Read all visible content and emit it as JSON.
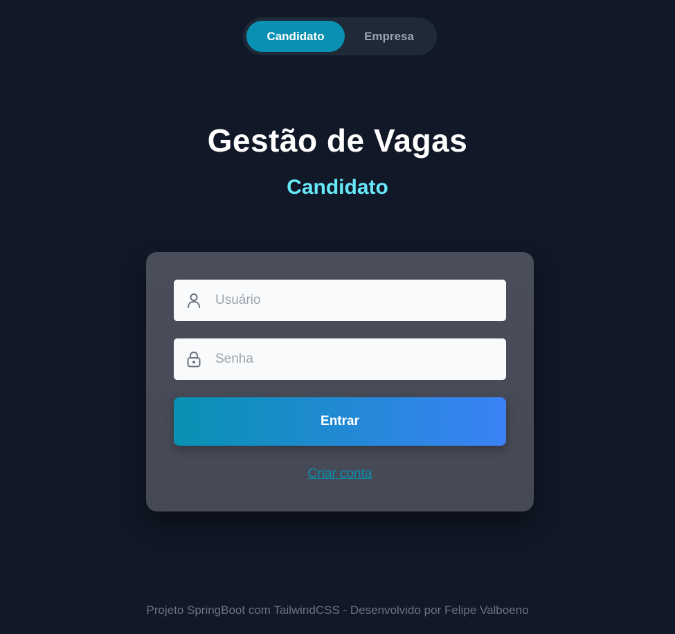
{
  "toggle": {
    "candidate_label": "Candidato",
    "company_label": "Empresa"
  },
  "header": {
    "title": "Gestão de Vagas",
    "subtitle": "Candidato"
  },
  "form": {
    "username_placeholder": "Usuário",
    "password_placeholder": "Senha",
    "username_value": "",
    "password_value": "",
    "submit_label": "Entrar",
    "create_account_label": "Criar conta",
    "icons": {
      "username": "user-icon",
      "password": "lock-icon"
    }
  },
  "footer": {
    "text": "Projeto SpringBoot com TailwindCSS - Desenvolvido por Felipe Valboeno"
  },
  "colors": {
    "background": "#111827",
    "accent": "#0891b2",
    "subtitle": "#67e8f9",
    "button_gradient_end": "#3b82f6",
    "card": "#4a4e5a"
  }
}
